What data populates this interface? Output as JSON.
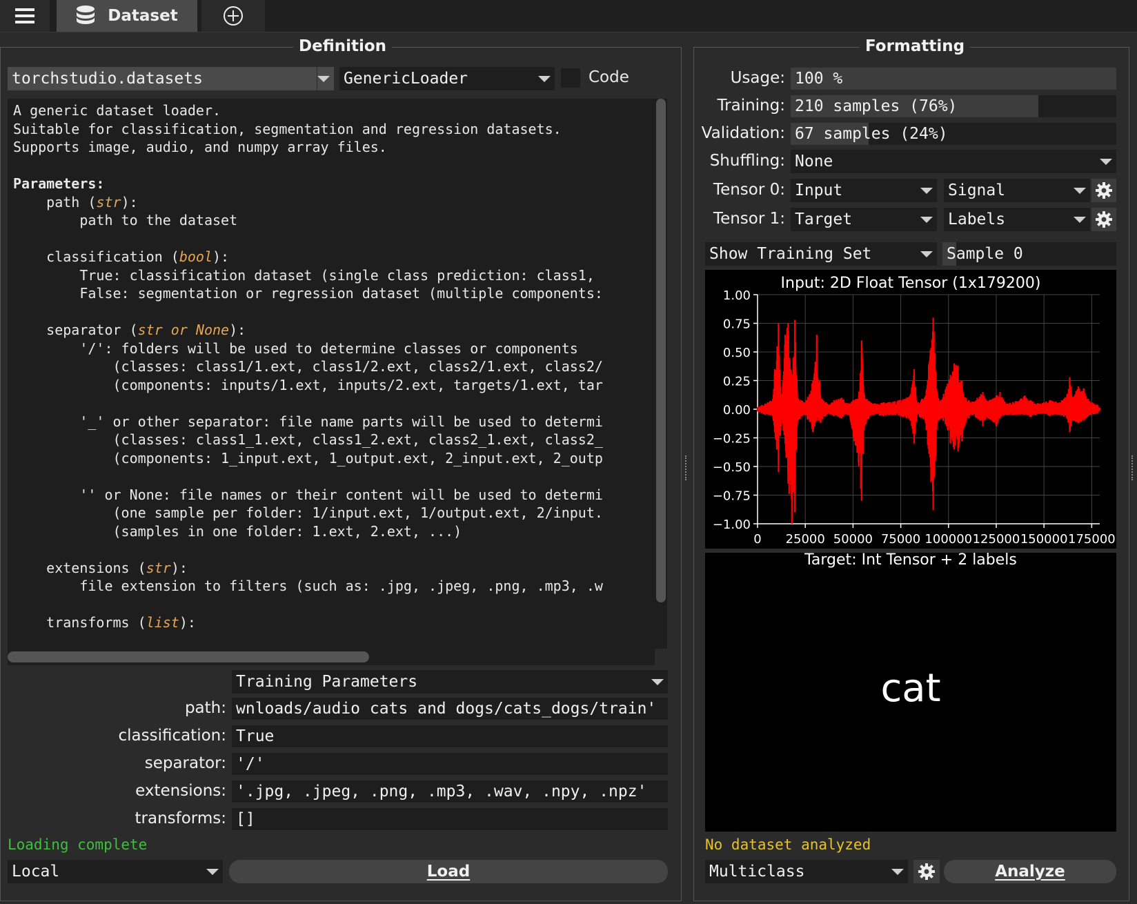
{
  "topbar": {
    "dataset_tab": "Dataset"
  },
  "definition": {
    "title": "Definition",
    "module": "torchstudio.datasets",
    "class": "GenericLoader",
    "code_label": "Code",
    "doc": {
      "l1": "A generic dataset loader.",
      "l2": "Suitable for classification, segmentation and regression datasets.",
      "l3": "Supports image, audio, and numpy array files.",
      "params": "Parameters:",
      "p1_name": "path",
      "p1_type": "str",
      "p1_desc": "path to the dataset",
      "p2_name": "classification",
      "p2_type": "bool",
      "p2_true": "True: classification dataset (single class prediction: class1,",
      "p2_false": "False: segmentation or regression dataset (multiple components:",
      "p3_name": "separator",
      "p3_type": "str or None",
      "p3_a": "'/': folders will be used to determine classes or components",
      "p3_b": "(classes: class1/1.ext, class1/2.ext, class2/1.ext, class2/",
      "p3_c": "(components: inputs/1.ext, inputs/2.ext, targets/1.ext, tar",
      "p3_d": "'_' or other separator: file name parts will be used to determi",
      "p3_e": "(classes: class1_1.ext, class1_2.ext, class2_1.ext, class2_",
      "p3_f": "(components: 1_input.ext, 1_output.ext, 2_input.ext, 2_outp",
      "p3_g": "'' or None: file names or their content will be used to determi",
      "p3_h": "(one sample per folder: 1/input.ext, 1/output.ext, 2/input.",
      "p3_i": "(samples in one folder: 1.ext, 2.ext, ...)",
      "p4_name": "extensions",
      "p4_type": "str",
      "p4_desc": "file extension to filters (such as: .jpg, .jpeg, .png, .mp3, .w",
      "p5_name": "transforms",
      "p5_type": "list"
    },
    "params_combo": "Training Parameters",
    "fields": [
      {
        "label": "path:",
        "value": "wnloads/audio cats and dogs/cats_dogs/train'"
      },
      {
        "label": "classification:",
        "value": "True"
      },
      {
        "label": "separator:",
        "value": "'/'"
      },
      {
        "label": "extensions:",
        "value": "'.jpg, .jpeg, .png, .mp3, .wav, .npy, .npz'"
      },
      {
        "label": "transforms:",
        "value": "[]"
      }
    ],
    "status": "Loading complete",
    "status_color": "#3fbf3f",
    "source": "Local",
    "load_button": "Load"
  },
  "formatting": {
    "title": "Formatting",
    "usage_label": "Usage:",
    "usage_value": "100 %",
    "usage_fraction": 1.0,
    "training_label": "Training:",
    "training_value": "210 samples (76%)",
    "training_fraction": 0.76,
    "validation_label": "Validation:",
    "validation_value": "67 samples (24%)",
    "validation_fraction": 0.24,
    "shuffling_label": "Shuffling:",
    "shuffling_value": "None",
    "tensor0_label": "Tensor 0:",
    "tensor0_type": "Input",
    "tensor0_renderer": "Signal",
    "tensor1_label": "Tensor 1:",
    "tensor1_type": "Target",
    "tensor1_renderer": "Labels",
    "view_combo": "Show Training Set",
    "sample_label": "Sample 0",
    "target_title": "Target: Int Tensor + 2 labels",
    "target_label": "cat",
    "status": "No dataset analyzed",
    "status_color": "#e6c22e",
    "analysis_type": "Multiclass",
    "analyze_button": "Analyze"
  },
  "chart_data": {
    "type": "line",
    "title": "Input: 2D Float Tensor (1x179200)",
    "xlim": [
      0,
      179200
    ],
    "ylim": [
      -1.0,
      1.0
    ],
    "x_ticks": [
      "0",
      "25000",
      "50000",
      "75000",
      "100000",
      "125000",
      "150000",
      "175000"
    ],
    "y_ticks": [
      "1.00",
      "0.75",
      "0.50",
      "0.25",
      "0.00",
      "−0.25",
      "−0.50",
      "−0.75",
      "−1.00"
    ],
    "grid": true,
    "series": [
      {
        "color": "#ff0000",
        "envelope": [
          [
            0,
            0.02,
            -0.02
          ],
          [
            4000,
            0.05,
            -0.05
          ],
          [
            8000,
            0.09,
            -0.06
          ],
          [
            9000,
            0.35,
            -0.2
          ],
          [
            11000,
            0.75,
            -0.55
          ],
          [
            12500,
            0.1,
            -0.08
          ],
          [
            14500,
            0.65,
            -0.3
          ],
          [
            16000,
            0.75,
            -0.65
          ],
          [
            18000,
            0.2,
            -1.0
          ],
          [
            19500,
            0.78,
            -0.9
          ],
          [
            21000,
            0.1,
            -0.1
          ],
          [
            25000,
            0.06,
            -0.05
          ],
          [
            29000,
            0.25,
            -0.2
          ],
          [
            31000,
            0.65,
            -0.1
          ],
          [
            33000,
            0.12,
            -0.12
          ],
          [
            37000,
            0.04,
            -0.04
          ],
          [
            40000,
            0.08,
            -0.06
          ],
          [
            44000,
            0.1,
            -0.08
          ],
          [
            48000,
            0.05,
            -0.05
          ],
          [
            53000,
            0.12,
            -0.5
          ],
          [
            54500,
            0.6,
            -0.8
          ],
          [
            56000,
            0.12,
            -0.15
          ],
          [
            60000,
            0.05,
            -0.05
          ],
          [
            66000,
            0.06,
            -0.06
          ],
          [
            72000,
            0.07,
            -0.05
          ],
          [
            78000,
            0.1,
            -0.08
          ],
          [
            80000,
            0.12,
            -0.1
          ],
          [
            82000,
            0.35,
            -0.3
          ],
          [
            83500,
            0.05,
            -0.05
          ],
          [
            88000,
            0.12,
            -0.12
          ],
          [
            92000,
            0.8,
            -0.88
          ],
          [
            94000,
            0.15,
            -0.12
          ],
          [
            96000,
            0.08,
            -0.08
          ],
          [
            99000,
            0.2,
            -0.15
          ],
          [
            101000,
            0.3,
            -0.3
          ],
          [
            103000,
            0.4,
            -0.35
          ],
          [
            105000,
            0.38,
            -0.37
          ],
          [
            107000,
            0.25,
            -0.28
          ],
          [
            109000,
            0.1,
            -0.12
          ],
          [
            112000,
            0.06,
            -0.05
          ],
          [
            115000,
            0.1,
            -0.08
          ],
          [
            118000,
            0.15,
            -0.15
          ],
          [
            120000,
            0.07,
            -0.07
          ],
          [
            125000,
            0.12,
            -0.15
          ],
          [
            127000,
            0.15,
            -0.08
          ],
          [
            130000,
            0.05,
            -0.05
          ],
          [
            135000,
            0.07,
            -0.05
          ],
          [
            140000,
            0.12,
            -0.05
          ],
          [
            143000,
            0.08,
            -0.07
          ],
          [
            148000,
            0.05,
            -0.04
          ],
          [
            153000,
            0.08,
            -0.06
          ],
          [
            158000,
            0.06,
            -0.05
          ],
          [
            162000,
            0.12,
            -0.08
          ],
          [
            163500,
            0.28,
            -0.2
          ],
          [
            165000,
            0.1,
            -0.1
          ],
          [
            168000,
            0.2,
            -0.12
          ],
          [
            171000,
            0.18,
            -0.1
          ],
          [
            174000,
            0.07,
            -0.05
          ],
          [
            178000,
            0.04,
            -0.04
          ],
          [
            179200,
            0.01,
            -0.01
          ]
        ]
      }
    ]
  }
}
